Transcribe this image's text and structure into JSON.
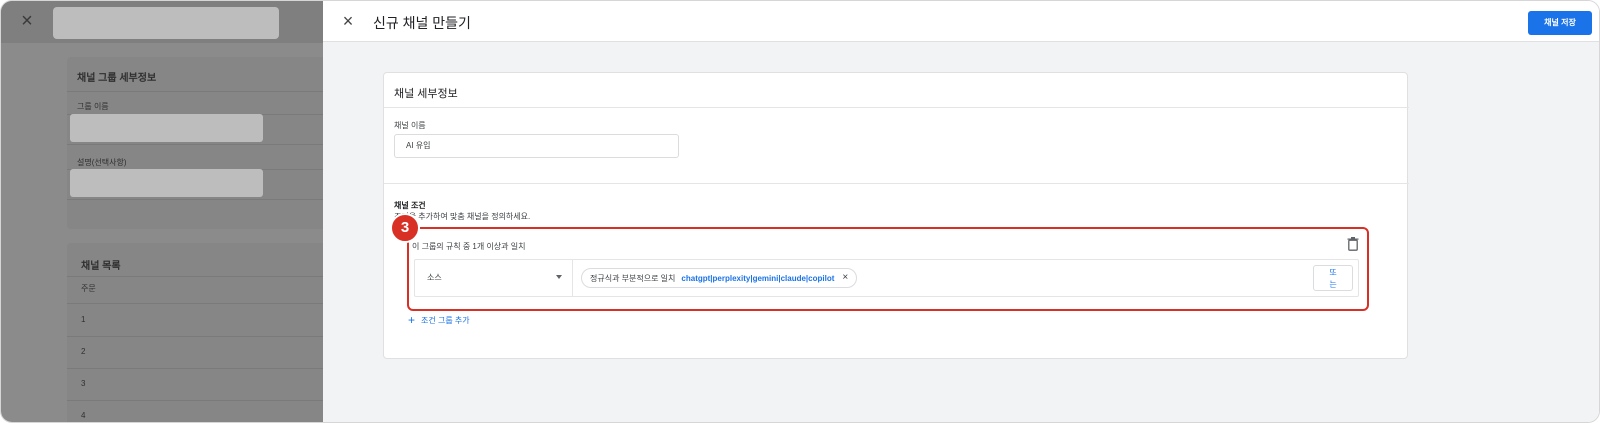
{
  "background": {
    "close_icon": "×",
    "group_details_title": "채널 그룹 세부정보",
    "group_name_label": "그룹 이름",
    "description_label": "설명(선택사항)",
    "channel_list_title": "채널 목록",
    "order_label": "주문",
    "rows": [
      "1",
      "2",
      "3",
      "4"
    ]
  },
  "modal": {
    "close_icon": "×",
    "title": "신규 채널 만들기",
    "save_label": "채널 저장",
    "details_title": "채널 세부정보",
    "name_label": "채널 이름",
    "name_value": "AI 유입",
    "conditions_title": "채널 조건",
    "conditions_desc": "조건을 추가하여 맞춤 채널을 정의하세요.",
    "group_header": "이 그룹의 규칙 중 1개 이상과 일치",
    "rule": {
      "dimension": "소스",
      "match_type": "정규식과 부분적으로 일치",
      "value": "chatgpt|perplexity|gemini|claude|copilot",
      "remove_icon": "×"
    },
    "or_label_line1": "또",
    "or_label_line2": "는",
    "add_group_label": "조건 그룹 추가",
    "add_icon": "+",
    "badge_number": "3"
  },
  "colors": {
    "accent": "#1a73e8",
    "highlight": "#d93025"
  }
}
